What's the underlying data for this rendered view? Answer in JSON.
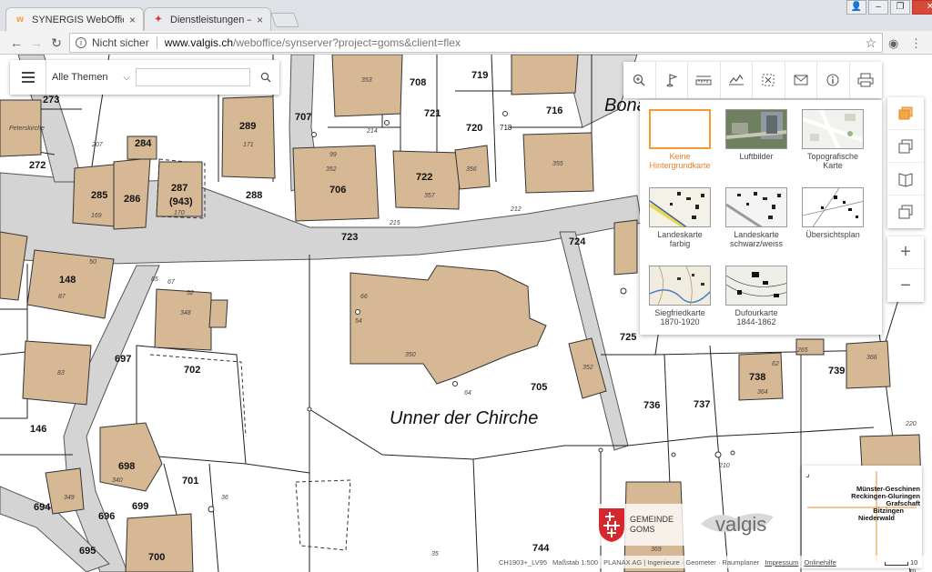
{
  "browser": {
    "tabs": [
      {
        "label": "SYNERGIS WebOffice Go",
        "active": true
      },
      {
        "label": "Dienstleistungen – valgis",
        "active": false
      }
    ],
    "url_secure_label": "Nicht sicher",
    "url_host": "www.valgis.ch",
    "url_path": "/weboffice/synserver?project=goms&client=flex"
  },
  "theme_panel": {
    "select_value": "Alle Themen",
    "search_placeholder": ""
  },
  "tools": [
    {
      "name": "zoom-icon"
    },
    {
      "name": "flag-icon"
    },
    {
      "name": "ruler-icon"
    },
    {
      "name": "profile-icon"
    },
    {
      "name": "select-icon"
    },
    {
      "name": "mail-icon"
    },
    {
      "name": "info-icon"
    },
    {
      "name": "print-icon"
    }
  ],
  "background_maps": [
    {
      "label": "Keine\nHintergrundkarte",
      "selected": true,
      "thumb": "blank"
    },
    {
      "label": "Luftbilder",
      "selected": false,
      "thumb": "aerial"
    },
    {
      "label": "Topografische\nKarte",
      "selected": false,
      "thumb": "topo"
    },
    {
      "label": "Landeskarte\nfarbig",
      "selected": false,
      "thumb": "lk-color"
    },
    {
      "label": "Landeskarte\nschwarz/weiss",
      "selected": false,
      "thumb": "lk-bw"
    },
    {
      "label": "Übersichtsplan",
      "selected": false,
      "thumb": "overview"
    },
    {
      "label": "Siegfriedkarte\n1870-1920",
      "selected": false,
      "thumb": "siegfried"
    },
    {
      "label": "Dufourkarte\n1844-1862",
      "selected": false,
      "thumb": "dufour"
    }
  ],
  "overview_map": {
    "places": [
      "Münster-Geschinen",
      "Reckingen-Gluringen",
      "Grafschaft",
      "Bitzingen",
      "Niederwald"
    ]
  },
  "logos": {
    "gemeinde_line1": "GEMEINDE",
    "gemeinde_line2": "GOMS",
    "valgis": "valgis"
  },
  "footer": {
    "crs": "CH1903+_LV95",
    "scale": "Maßstab 1:500",
    "credits": "PLANAX AG | Ingenieure · Geometer · Raumplaner",
    "impressum": "Impressum",
    "onlinehilfe": "Onlinehilfe",
    "scalebar_label": "10 m"
  },
  "map": {
    "place_name": "Unner der Chirche",
    "street_label": "Bona",
    "parcels": [
      "273",
      "708",
      "719",
      "289",
      "707",
      "721",
      "716",
      "720",
      "718",
      "284",
      "272",
      "285",
      "286",
      "287",
      "(943)",
      "288",
      "706",
      "722",
      "723",
      "724",
      "148",
      "697",
      "702",
      "705",
      "725",
      "736",
      "737",
      "738",
      "739",
      "146",
      "698",
      "701",
      "694",
      "699",
      "696",
      "695",
      "700",
      "744",
      "704"
    ],
    "small_numbers": [
      "353",
      "214",
      "171",
      "99",
      "352",
      "356",
      "357",
      "355",
      "215",
      "212",
      "50",
      "87",
      "52",
      "348",
      "66",
      "54",
      "350",
      "64",
      "83",
      "340",
      "349",
      "36",
      "35",
      "210",
      "220",
      "366",
      "364",
      "265",
      "62",
      "369",
      "67",
      "85",
      "207",
      "93",
      "169",
      "170",
      "352"
    ]
  }
}
